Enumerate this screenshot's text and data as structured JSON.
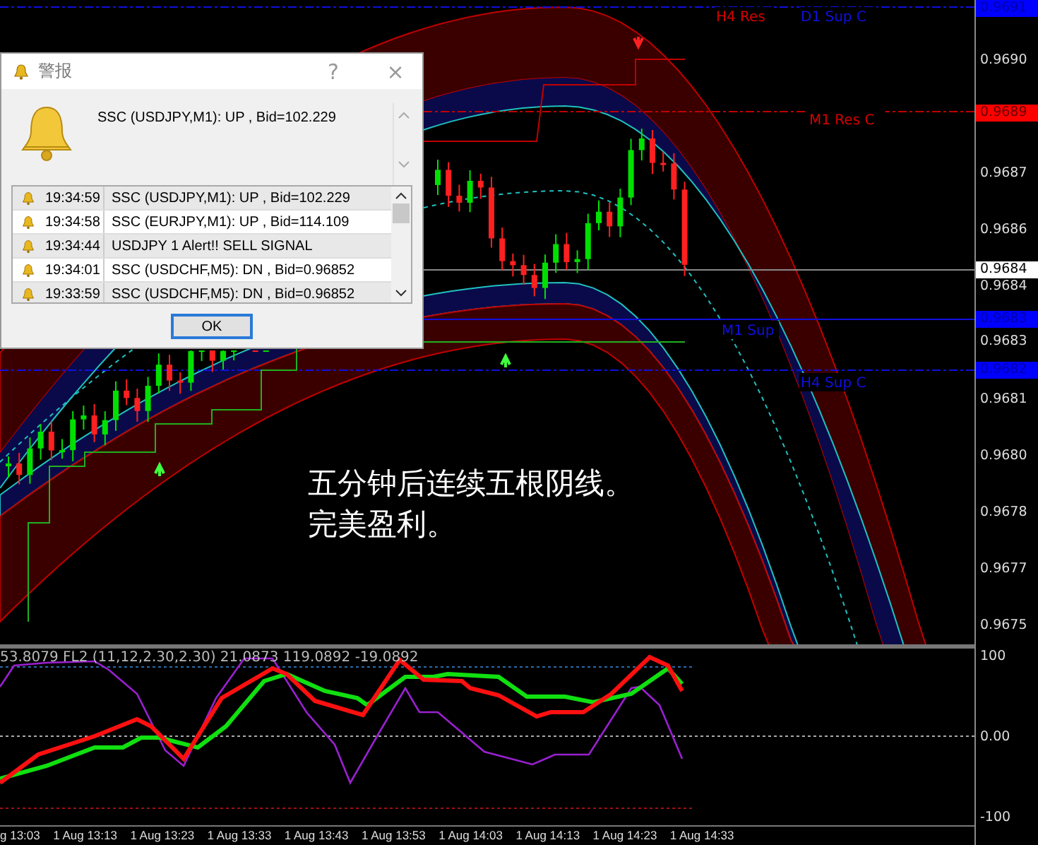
{
  "chart_labels": [
    {
      "text": "H4 Res",
      "color": "#d40000"
    },
    {
      "text": "D1 Sup C",
      "color": "#1010e0"
    },
    {
      "text": "M1 Res C",
      "color": "#d40000"
    },
    {
      "text": "M1 Sup",
      "color": "#1010e0"
    },
    {
      "text": "H4 Sup C",
      "color": "#1010e0"
    }
  ],
  "overlay_text": [
    "五分钟后连续五根阴线。",
    "完美盈利。"
  ],
  "indicator_caption": "53.8079  FL2 (11,12,2.30,2.30) 21.0873 119.0892 -19.0892",
  "price_axis": [
    {
      "label": "0.9691",
      "kind": "marker",
      "color": "#0000ff"
    },
    {
      "label": "0.9690",
      "kind": "tick"
    },
    {
      "label": "0.9689",
      "kind": "marker",
      "color": "#ff0000"
    },
    {
      "label": "0.9687",
      "kind": "tick"
    },
    {
      "label": "0.9686",
      "kind": "tick"
    },
    {
      "label": "0.9684",
      "kind": "marker",
      "color": "#ffffff"
    },
    {
      "label": "0.9684",
      "kind": "tick"
    },
    {
      "label": "0.9683",
      "kind": "marker",
      "color": "#0000ff"
    },
    {
      "label": "0.9683",
      "kind": "tick"
    },
    {
      "label": "0.9682",
      "kind": "marker",
      "color": "#0000ff"
    },
    {
      "label": "0.9681",
      "kind": "tick"
    },
    {
      "label": "0.9680",
      "kind": "tick"
    },
    {
      "label": "0.9678",
      "kind": "tick"
    },
    {
      "label": "0.9677",
      "kind": "tick"
    },
    {
      "label": "0.9675",
      "kind": "tick"
    }
  ],
  "oscillator_axis": [
    "100",
    "0.00",
    "-100"
  ],
  "time_axis": [
    "g 13:03",
    "1 Aug 13:13",
    "1 Aug 13:23",
    "1 Aug 13:33",
    "1 Aug 13:43",
    "1 Aug 13:53",
    "1 Aug 14:03",
    "1 Aug 14:13",
    "1 Aug 14:23",
    "1 Aug 14:33"
  ],
  "alert_dialog": {
    "title": "警报",
    "help": "?",
    "close": "×",
    "message": "SSC (USDJPY,M1): UP , Bid=102.229",
    "alerts": [
      {
        "time": "19:34:59",
        "text": "SSC (USDJPY,M1): UP , Bid=102.229"
      },
      {
        "time": "19:34:58",
        "text": "SSC (EURJPY,M1): UP , Bid=114.109"
      },
      {
        "time": "19:34:44",
        "text": "USDJPY 1 Alert!! SELL SIGNAL"
      },
      {
        "time": "19:34:01",
        "text": "SSC (USDCHF,M5): DN , Bid=0.96852"
      },
      {
        "time": "19:33:59",
        "text": "SSC (USDCHF,M5): DN , Bid=0.96852"
      }
    ],
    "ok": "OK"
  }
}
